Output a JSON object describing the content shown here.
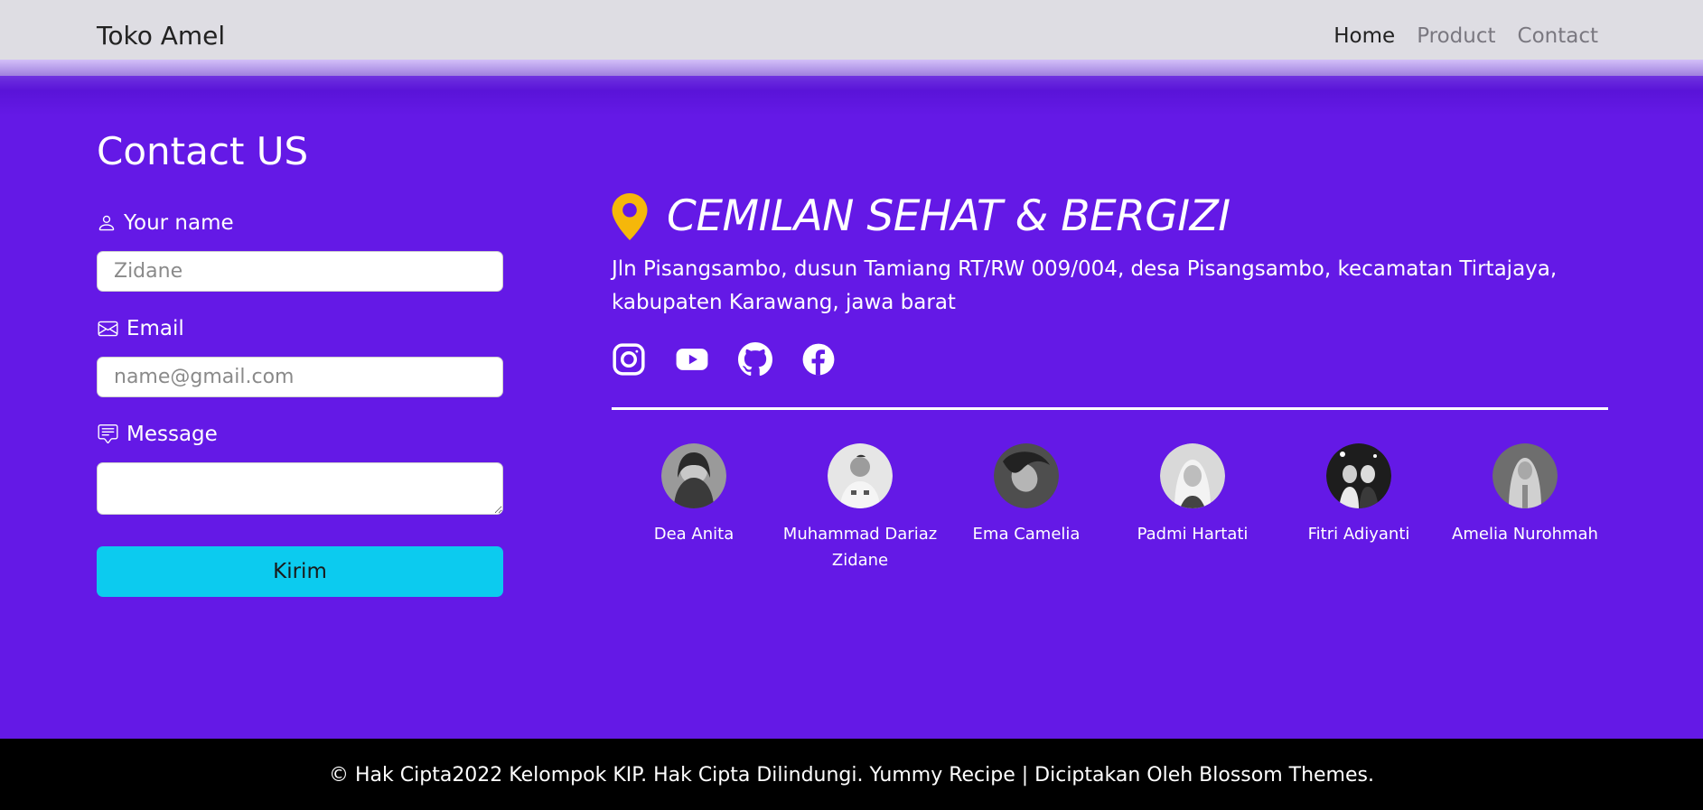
{
  "nav": {
    "brand": "Toko Amel",
    "links": [
      "Home",
      "Product",
      "Contact"
    ]
  },
  "contact": {
    "title": "Contact US",
    "name_label": "Your name",
    "name_placeholder": "Zidane",
    "email_label": "Email",
    "email_placeholder": "name@gmail.com",
    "message_label": "Message",
    "message_placeholder": "",
    "submit_label": "Kirim"
  },
  "store": {
    "name": "CEMILAN SEHAT & BERGIZI",
    "address": "Jln Pisangsambo, dusun Tamiang RT/RW 009/004, desa Pisangsambo, kecamatan Tirtajaya, kabupaten Karawang, jawa barat",
    "socials": [
      "instagram-icon",
      "youtube-icon",
      "github-icon",
      "facebook-icon"
    ]
  },
  "team": [
    "Dea Anita",
    "Muhammad Dariaz Zidane",
    "Ema Camelia",
    "Padmi Hartati",
    "Fitri Adiyanti",
    "Amelia Nurohmah"
  ],
  "footer": {
    "text": "© Hak Cipta2022 Kelompok KIP. Hak Cipta Dilindungi. Yummy Recipe | Diciptakan Oleh Blossom Themes."
  },
  "colors": {
    "background": "#6419e6",
    "navbar": "#dedde3",
    "button": "#0ccbef",
    "location_pin": "#f5b70a",
    "footer": "#000000"
  }
}
